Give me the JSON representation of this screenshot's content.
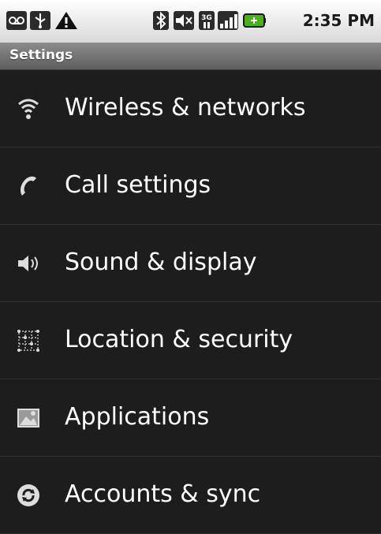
{
  "status_bar": {
    "time": "2:35 PM",
    "icons": [
      "voicemail-icon",
      "usb-icon",
      "warning-icon",
      "bluetooth-icon",
      "mute-icon",
      "3g-icon",
      "signal-icon",
      "battery-icon"
    ],
    "net_label": "3G"
  },
  "title_bar": {
    "title": "Settings"
  },
  "settings": {
    "items": [
      {
        "label": "Wireless & networks",
        "icon": "wifi-icon"
      },
      {
        "label": "Call settings",
        "icon": "phone-icon"
      },
      {
        "label": "Sound & display",
        "icon": "speaker-icon"
      },
      {
        "label": "Location & security",
        "icon": "grid-icon"
      },
      {
        "label": "Applications",
        "icon": "applications-icon"
      },
      {
        "label": "Accounts & sync",
        "icon": "sync-icon"
      }
    ]
  },
  "colors": {
    "background": "#1f1f1f",
    "text": "#ffffff",
    "battery_accent": "#4caf20"
  }
}
